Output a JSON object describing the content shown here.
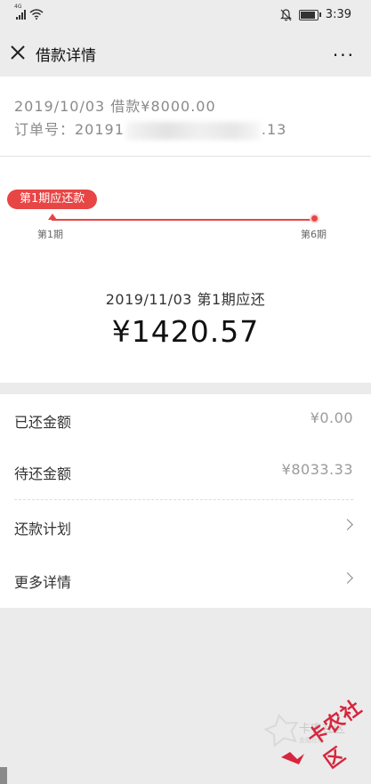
{
  "statusbar": {
    "network": "4G",
    "time": "3:39"
  },
  "navbar": {
    "title": "借款详情",
    "more": "···"
  },
  "loan": {
    "summary": "2019/10/03 借款¥8000.00",
    "order_prefix": "订单号：20191",
    "order_suffix": ".13"
  },
  "schedule": {
    "current_tag": "第1期应还款",
    "start_label": "第1期",
    "end_label": "第6期",
    "due_text": "2019/11/03 第1期应还",
    "due_amount": "¥1420.57"
  },
  "details": {
    "repaid_label": "已还金额",
    "repaid_value": "¥0.00",
    "pending_label": "待还金额",
    "pending_value": "¥8033.33",
    "plan_label": "还款计划",
    "more_label": "更多详情"
  },
  "watermark": {
    "small": "卡农社区",
    "tiny": "金融在线",
    "big": "卡农社区"
  },
  "colors": {
    "accent": "#e84545",
    "text": "#333333",
    "muted": "#8a8a8a",
    "background": "#ebebeb"
  },
  "icons": [
    "signal-icon",
    "wifi-icon",
    "mute-bell-icon",
    "battery-icon",
    "close-icon",
    "more-icon",
    "chevron-right-icon"
  ]
}
